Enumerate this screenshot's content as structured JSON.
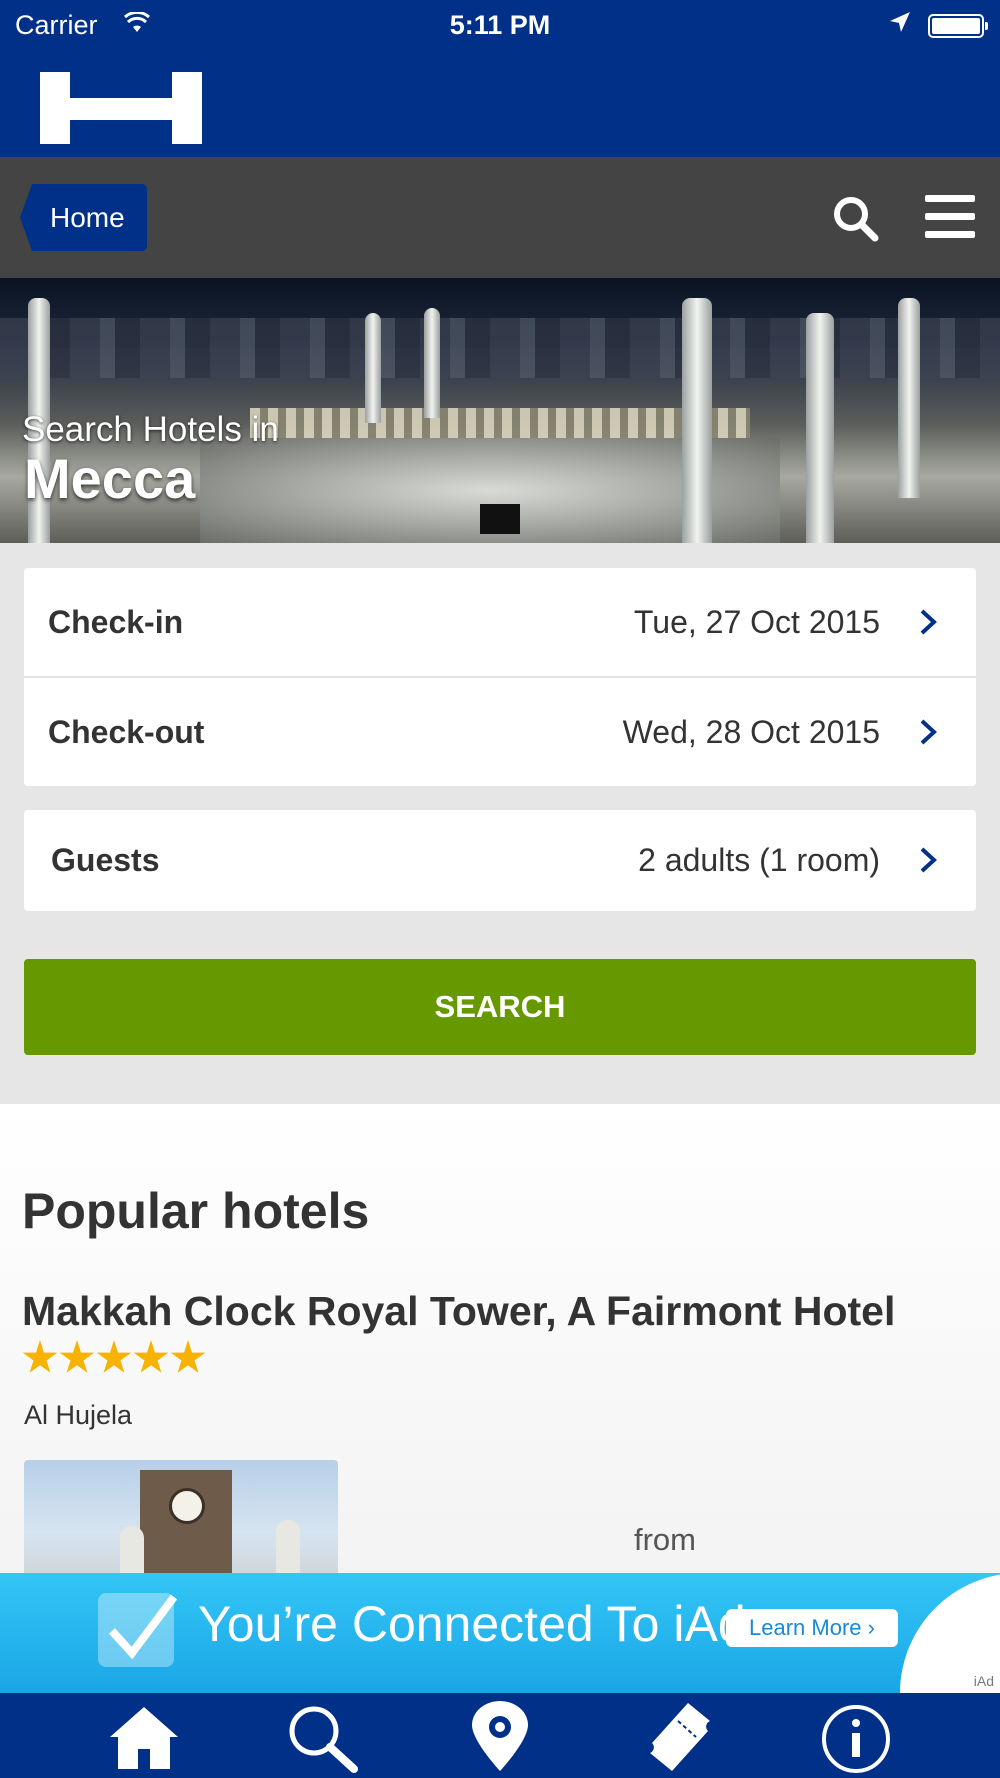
{
  "status_bar": {
    "carrier": "Carrier",
    "time": "5:11 PM",
    "icons": [
      "wifi-icon",
      "location-arrow-icon",
      "battery-icon"
    ]
  },
  "header": {
    "logo_icon": "hotels-h-logo",
    "brand_color": "#003087"
  },
  "nav": {
    "home_label": "Home",
    "icons": [
      "search-icon",
      "hamburger-menu-icon"
    ]
  },
  "hero": {
    "subtitle": "Search Hotels in",
    "city": "Mecca"
  },
  "form": {
    "checkin": {
      "label": "Check-in",
      "value": "Tue, 27 Oct 2015"
    },
    "checkout": {
      "label": "Check-out",
      "value": "Wed, 28 Oct 2015"
    },
    "guests": {
      "label": "Guests",
      "value": "2 adults (1 room)"
    },
    "search_label": "SEARCH",
    "search_color": "#669900"
  },
  "popular": {
    "heading": "Popular hotels",
    "hotels": [
      {
        "name": "Makkah Clock Royal Tower, A Fairmont Hotel",
        "stars": 5,
        "district": "Al Hujela",
        "price_prefix": "from"
      }
    ]
  },
  "ad": {
    "text": "You’re Connected To iAd",
    "button": "Learn More ›",
    "badge": "iAd"
  },
  "tab_bar": {
    "items": [
      "home-icon",
      "search-icon",
      "map-pin-icon",
      "ticket-icon",
      "info-icon"
    ]
  }
}
